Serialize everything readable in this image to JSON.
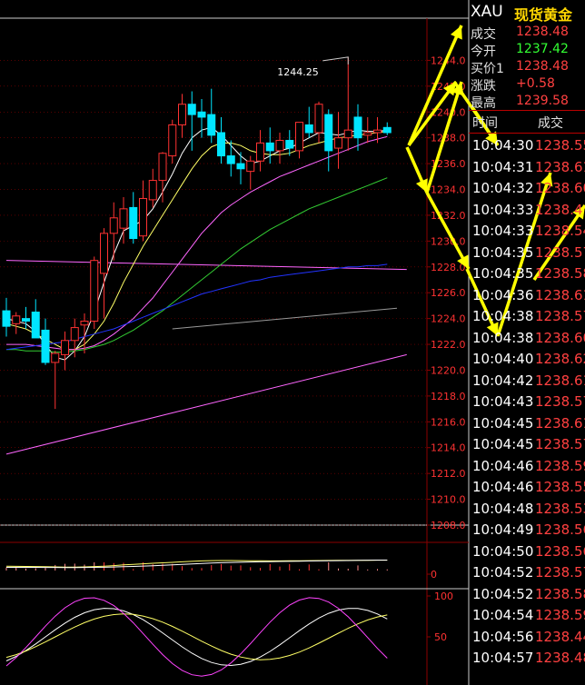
{
  "quote": {
    "symbol": "XAU",
    "name": "现货黄金",
    "rows": [
      {
        "label": "成交",
        "value": "1238.48",
        "color": "#ff4040"
      },
      {
        "label": "今开",
        "value": "1237.42",
        "color": "#33ff33"
      },
      {
        "label": "买价1",
        "value": "1238.48",
        "color": "#ff4040"
      },
      {
        "label": "涨跌",
        "value": "+0.58",
        "color": "#ff4040"
      },
      {
        "label": "最高",
        "value": "1239.58",
        "color": "#ff4040"
      }
    ]
  },
  "ticks": {
    "time_header": "时间",
    "price_header": "成交",
    "rows": [
      {
        "time": "10:04:30",
        "price": "1238.55"
      },
      {
        "time": "10:04:31",
        "price": "1238.61"
      },
      {
        "time": "10:04:32",
        "price": "1238.60"
      },
      {
        "time": "10:04:33",
        "price": "1238.4"
      },
      {
        "time": "10:04:33",
        "price": "1238.54"
      },
      {
        "time": "10:04:35",
        "price": "1238.57"
      },
      {
        "time": "10:04:35",
        "price": "1238.58"
      },
      {
        "time": "10:04:36",
        "price": "1238.61"
      },
      {
        "time": "10:04:38",
        "price": "1238.57"
      },
      {
        "time": "10:04:38",
        "price": "1238.60"
      },
      {
        "time": "10:04:40",
        "price": "1238.62"
      },
      {
        "time": "10:04:42",
        "price": "1238.61"
      },
      {
        "time": "10:04:43",
        "price": "1238.57"
      },
      {
        "time": "10:04:45",
        "price": "1238.61"
      },
      {
        "time": "10:04:45",
        "price": "1238.57"
      },
      {
        "time": "10:04:46",
        "price": "1238.59"
      },
      {
        "time": "10:04:46",
        "price": "1238.55"
      },
      {
        "time": "10:04:48",
        "price": "1238.53"
      },
      {
        "time": "10:04:49",
        "price": "1238.56"
      },
      {
        "time": "10:04:50",
        "price": "1238.56"
      },
      {
        "time": "10:04:52",
        "price": "1238.57"
      },
      {
        "time": "10:04:52",
        "price": "1238.58"
      },
      {
        "time": "10:04:54",
        "price": "1238.59"
      },
      {
        "time": "10:04:56",
        "price": "1238.44"
      },
      {
        "time": "10:04:57",
        "price": "1238.48"
      }
    ]
  },
  "colors": {
    "up": "#ff3232",
    "down": "#00e5ff",
    "grid": "#8b0000",
    "axis_text": "#ff3232",
    "annotation_arrow": "#ffff00"
  },
  "chart_data": {
    "type": "candlestick",
    "price_axis": {
      "labels": [
        "1244.0",
        "1242.0",
        "1240.0",
        "1238.0",
        "1236.0",
        "1234.0",
        "1232.0",
        "1230.0",
        "1228.0",
        "1226.0",
        "1224.0",
        "1222.0",
        "1220.0",
        "1218.0",
        "1216.0",
        "1214.0",
        "1212.0",
        "1210.0",
        "1208.0"
      ],
      "ylim": [
        1208,
        1246
      ]
    },
    "peak_annotation": "1244.25",
    "candles": [
      {
        "o": 1224.6,
        "h": 1225.6,
        "l": 1222.6,
        "c": 1223.4
      },
      {
        "o": 1223.6,
        "h": 1224.5,
        "l": 1222.8,
        "c": 1224.2
      },
      {
        "o": 1224.0,
        "h": 1224.9,
        "l": 1223.2,
        "c": 1223.8
      },
      {
        "o": 1224.5,
        "h": 1225.5,
        "l": 1222.6,
        "c": 1222.5
      },
      {
        "o": 1223.1,
        "h": 1224.0,
        "l": 1220.4,
        "c": 1220.6
      },
      {
        "o": 1220.6,
        "h": 1221.5,
        "l": 1217.0,
        "c": 1221.3
      },
      {
        "o": 1221.2,
        "h": 1223.0,
        "l": 1220.0,
        "c": 1222.3
      },
      {
        "o": 1222.3,
        "h": 1224.0,
        "l": 1221.0,
        "c": 1223.3
      },
      {
        "o": 1223.5,
        "h": 1224.4,
        "l": 1221.3,
        "c": 1223.8
      },
      {
        "o": 1223.8,
        "h": 1228.8,
        "l": 1223.2,
        "c": 1228.5
      },
      {
        "o": 1227.5,
        "h": 1231.0,
        "l": 1224.0,
        "c": 1230.6
      },
      {
        "o": 1230.6,
        "h": 1233.0,
        "l": 1228.5,
        "c": 1231.8
      },
      {
        "o": 1231.0,
        "h": 1233.4,
        "l": 1229.8,
        "c": 1232.5
      },
      {
        "o": 1232.6,
        "h": 1233.8,
        "l": 1229.8,
        "c": 1230.2
      },
      {
        "o": 1230.4,
        "h": 1234.7,
        "l": 1230.0,
        "c": 1233.3
      },
      {
        "o": 1233.2,
        "h": 1235.6,
        "l": 1232.6,
        "c": 1234.7
      },
      {
        "o": 1234.7,
        "h": 1236.9,
        "l": 1233.0,
        "c": 1236.8
      },
      {
        "o": 1236.6,
        "h": 1239.4,
        "l": 1236.0,
        "c": 1239.0
      },
      {
        "o": 1239.0,
        "h": 1241.4,
        "l": 1238.0,
        "c": 1240.6
      },
      {
        "o": 1240.6,
        "h": 1241.6,
        "l": 1237.0,
        "c": 1239.8
      },
      {
        "o": 1240.0,
        "h": 1241.0,
        "l": 1238.0,
        "c": 1239.6
      },
      {
        "o": 1239.8,
        "h": 1241.8,
        "l": 1237.6,
        "c": 1238.2
      },
      {
        "o": 1238.4,
        "h": 1239.6,
        "l": 1236.0,
        "c": 1236.6
      },
      {
        "o": 1236.6,
        "h": 1237.8,
        "l": 1235.0,
        "c": 1236.0
      },
      {
        "o": 1236.0,
        "h": 1236.9,
        "l": 1234.4,
        "c": 1235.6
      },
      {
        "o": 1235.4,
        "h": 1236.6,
        "l": 1234.0,
        "c": 1236.2
      },
      {
        "o": 1236.2,
        "h": 1238.6,
        "l": 1235.4,
        "c": 1237.6
      },
      {
        "o": 1237.6,
        "h": 1238.8,
        "l": 1236.0,
        "c": 1237.0
      },
      {
        "o": 1237.0,
        "h": 1238.4,
        "l": 1236.0,
        "c": 1237.8
      },
      {
        "o": 1237.8,
        "h": 1238.6,
        "l": 1236.6,
        "c": 1237.2
      },
      {
        "o": 1237.0,
        "h": 1239.2,
        "l": 1236.4,
        "c": 1239.2
      },
      {
        "o": 1239.0,
        "h": 1240.4,
        "l": 1238.0,
        "c": 1238.4
      },
      {
        "o": 1238.4,
        "h": 1240.8,
        "l": 1237.6,
        "c": 1240.6
      },
      {
        "o": 1239.8,
        "h": 1240.2,
        "l": 1235.4,
        "c": 1237.0
      },
      {
        "o": 1237.2,
        "h": 1240.0,
        "l": 1235.6,
        "c": 1238.0
      },
      {
        "o": 1238.0,
        "h": 1244.25,
        "l": 1237.0,
        "c": 1238.6
      },
      {
        "o": 1239.6,
        "h": 1240.6,
        "l": 1237.0,
        "c": 1238.0
      },
      {
        "o": 1238.2,
        "h": 1239.6,
        "l": 1237.6,
        "c": 1238.4
      },
      {
        "o": 1238.4,
        "h": 1239.6,
        "l": 1237.6,
        "c": 1238.6
      },
      {
        "o": 1238.8,
        "h": 1239.2,
        "l": 1238.2,
        "c": 1238.4
      }
    ],
    "moving_averages": [
      {
        "color": "#ffffff",
        "values": [
          1224.0,
          1223.8,
          1223.6,
          1223.0,
          1222.0,
          1221.0,
          1220.8,
          1221.5,
          1222.6,
          1224.5,
          1226.8,
          1229.0,
          1230.8,
          1231.2,
          1231.6,
          1232.5,
          1233.8,
          1235.2,
          1236.8,
          1238.0,
          1238.6,
          1238.8,
          1238.2,
          1237.4,
          1236.6,
          1236.0,
          1236.2,
          1236.6,
          1237.0,
          1237.2,
          1237.6,
          1238.0,
          1238.4,
          1238.3,
          1238.2,
          1238.4,
          1238.6,
          1238.5,
          1238.5,
          1238.6
        ]
      },
      {
        "color": "#ffff66",
        "values": [
          1223.6,
          1223.4,
          1223.2,
          1222.8,
          1222.4,
          1222.0,
          1221.6,
          1221.6,
          1222.0,
          1222.8,
          1223.8,
          1225.2,
          1226.8,
          1228.2,
          1229.6,
          1230.8,
          1232.0,
          1233.2,
          1234.4,
          1235.6,
          1236.6,
          1237.3,
          1237.6,
          1237.6,
          1237.4,
          1237.0,
          1236.8,
          1236.7,
          1236.7,
          1236.8,
          1237.1,
          1237.4,
          1237.6,
          1237.8,
          1238.0,
          1238.1,
          1238.2,
          1238.3,
          1238.4,
          1238.5
        ]
      },
      {
        "color": "#ff66ff",
        "values": [
          1222.0,
          1222.0,
          1222.0,
          1221.9,
          1221.8,
          1221.7,
          1221.6,
          1221.6,
          1221.7,
          1221.9,
          1222.3,
          1222.8,
          1223.4,
          1224.0,
          1224.8,
          1225.6,
          1226.6,
          1227.6,
          1228.6,
          1229.6,
          1230.6,
          1231.4,
          1232.2,
          1232.8,
          1233.3,
          1233.8,
          1234.2,
          1234.6,
          1235.0,
          1235.3,
          1235.6,
          1235.9,
          1236.2,
          1236.5,
          1236.8,
          1237.1,
          1237.4,
          1237.7,
          1237.9,
          1238.1
        ]
      },
      {
        "color": "#33cc33",
        "values": [
          1221.6,
          1221.6,
          1221.5,
          1221.5,
          1221.5,
          1221.4,
          1221.4,
          1221.5,
          1221.6,
          1221.8,
          1222.0,
          1222.3,
          1222.7,
          1223.1,
          1223.6,
          1224.1,
          1224.6,
          1225.2,
          1225.8,
          1226.4,
          1227.0,
          1227.6,
          1228.2,
          1228.8,
          1229.4,
          1229.9,
          1230.4,
          1230.9,
          1231.3,
          1231.7,
          1232.1,
          1232.5,
          1232.8,
          1233.1,
          1233.4,
          1233.7,
          1234.0,
          1234.3,
          1234.6,
          1234.9
        ]
      },
      {
        "color": "#2233ff",
        "values": [
          1221.6,
          1221.7,
          1221.8,
          1221.9,
          1222.0,
          1222.1,
          1222.2,
          1222.4,
          1222.6,
          1222.8,
          1223.0,
          1223.2,
          1223.5,
          1223.8,
          1224.1,
          1224.4,
          1224.7,
          1225.0,
          1225.3,
          1225.6,
          1225.9,
          1226.1,
          1226.3,
          1226.5,
          1226.7,
          1226.9,
          1227.0,
          1227.2,
          1227.3,
          1227.4,
          1227.5,
          1227.6,
          1227.7,
          1227.8,
          1227.9,
          1228.0,
          1228.0,
          1228.1,
          1228.1,
          1228.2
        ]
      }
    ],
    "trend_lines": [
      {
        "color": "#ff66ff",
        "from": [
          0,
          1228.5
        ],
        "to": [
          41,
          1227.8
        ]
      },
      {
        "color": "#ff66ff",
        "from": [
          0,
          1213.5
        ],
        "to": [
          41,
          1221.2
        ]
      },
      {
        "color": "#999999",
        "from": [
          17,
          1223.2
        ],
        "to": [
          40,
          1224.8
        ]
      }
    ],
    "macd_axis_label": "0",
    "kdj_axis": [
      "100",
      "50"
    ]
  }
}
